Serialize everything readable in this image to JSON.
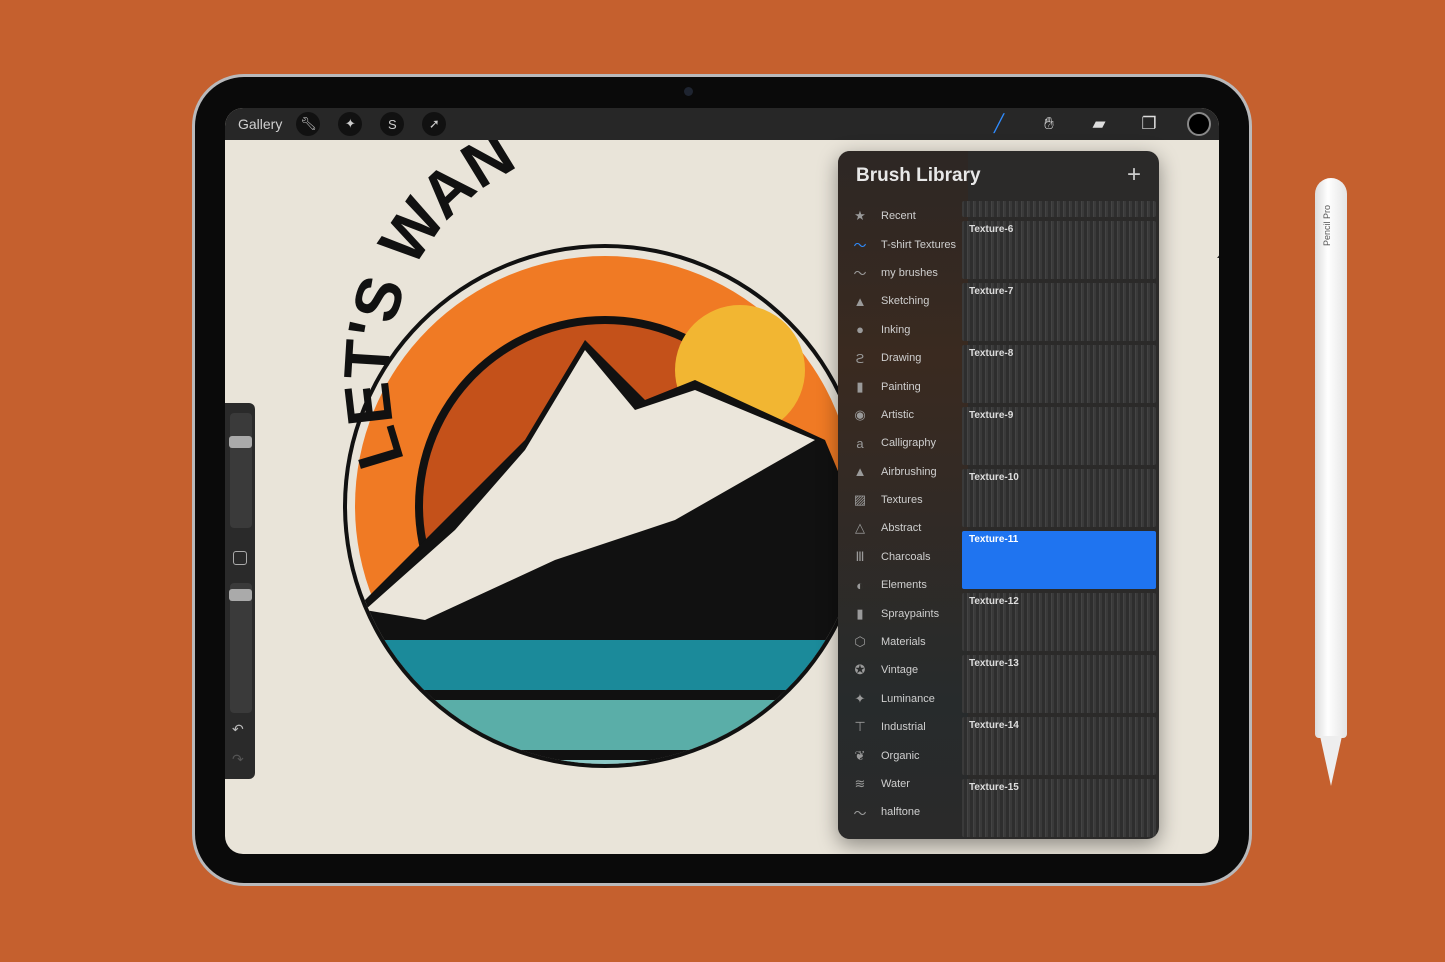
{
  "toolbar": {
    "gallery_label": "Gallery",
    "left_tools": [
      "wrench-icon",
      "magic-wand-icon",
      "selection-s-icon",
      "move-arrow-icon"
    ],
    "right_tools": [
      "brush-icon",
      "smudge-icon",
      "eraser-icon",
      "layers-icon"
    ],
    "current_color": "#000000"
  },
  "brush_library": {
    "title": "Brush Library",
    "add_label": "+",
    "categories": [
      {
        "label": "Recent",
        "icon": "★"
      },
      {
        "label": "T-shirt Textures",
        "icon": "〜"
      },
      {
        "label": "my brushes",
        "icon": "〜"
      },
      {
        "label": "Sketching",
        "icon": "▲"
      },
      {
        "label": "Inking",
        "icon": "●"
      },
      {
        "label": "Drawing",
        "icon": "ϩ"
      },
      {
        "label": "Painting",
        "icon": "▮"
      },
      {
        "label": "Artistic",
        "icon": "◉"
      },
      {
        "label": "Calligraphy",
        "icon": "a"
      },
      {
        "label": "Airbrushing",
        "icon": "▲"
      },
      {
        "label": "Textures",
        "icon": "▨"
      },
      {
        "label": "Abstract",
        "icon": "△"
      },
      {
        "label": "Charcoals",
        "icon": "Ⅲ"
      },
      {
        "label": "Elements",
        "icon": "◐"
      },
      {
        "label": "Spraypaints",
        "icon": "▮"
      },
      {
        "label": "Materials",
        "icon": "⬡"
      },
      {
        "label": "Vintage",
        "icon": "✪"
      },
      {
        "label": "Luminance",
        "icon": "✦"
      },
      {
        "label": "Industrial",
        "icon": "⊤"
      },
      {
        "label": "Organic",
        "icon": "❦"
      },
      {
        "label": "Water",
        "icon": "≋"
      },
      {
        "label": "halftone",
        "icon": "〜"
      }
    ],
    "selected_category": "T-shirt Textures",
    "brushes": [
      "Texture-6",
      "Texture-7",
      "Texture-8",
      "Texture-9",
      "Texture-10",
      "Texture-11",
      "Texture-12",
      "Texture-13",
      "Texture-14",
      "Texture-15"
    ],
    "selected_brush": "Texture-11"
  },
  "artwork": {
    "text": "LET'S WAN"
  },
  "pencil": {
    "label": "Pencil Pro"
  },
  "colors": {
    "background": "#c5602e",
    "accent": "#1f74f0",
    "orange": "#f07a24",
    "teal": "#1b8a9a"
  }
}
